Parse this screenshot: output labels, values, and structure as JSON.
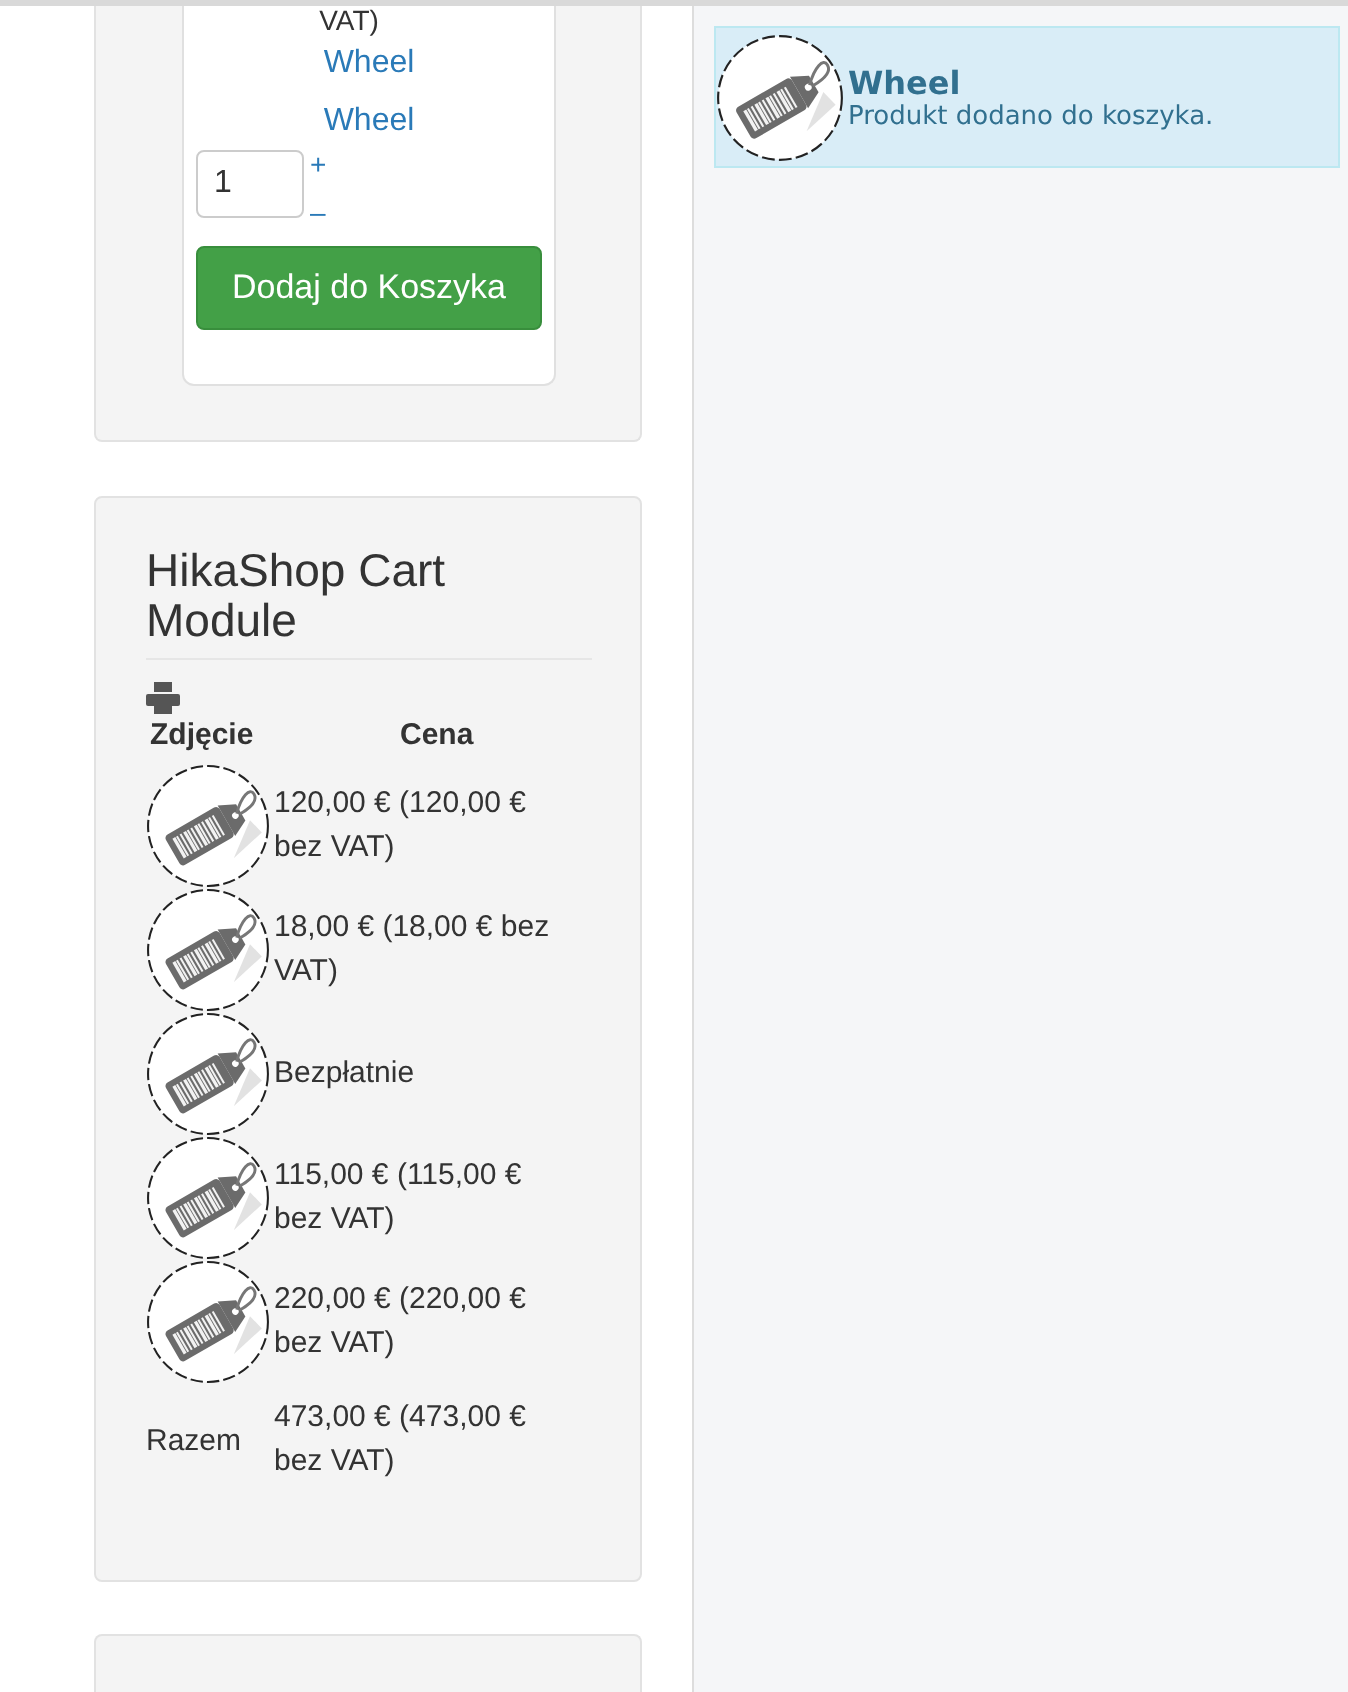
{
  "product_card": {
    "price_tail": "VAT)",
    "links": [
      "Wheel",
      "Wheel"
    ],
    "quantity": "1",
    "increase": "+",
    "decrease": "–",
    "add_button": "Dodaj do Koszyka"
  },
  "cart_module": {
    "title": "HikaShop Cart Module",
    "columns": [
      "Zdjęcie",
      "Cena"
    ],
    "rows": [
      {
        "price": "120,00 € (120,00 € bez VAT)"
      },
      {
        "price": "18,00 € (18,00 € bez VAT)"
      },
      {
        "price": "Bezpłatnie"
      },
      {
        "price": "115,00 € (115,00 € bez VAT)"
      },
      {
        "price": "220,00 € (220,00 € bez VAT)"
      }
    ],
    "total": {
      "label": "Razem",
      "price": "473,00 € (473,00 € bez VAT)"
    }
  },
  "notification": {
    "title": "Wheel",
    "message": "Produkt dodano do koszyka."
  }
}
